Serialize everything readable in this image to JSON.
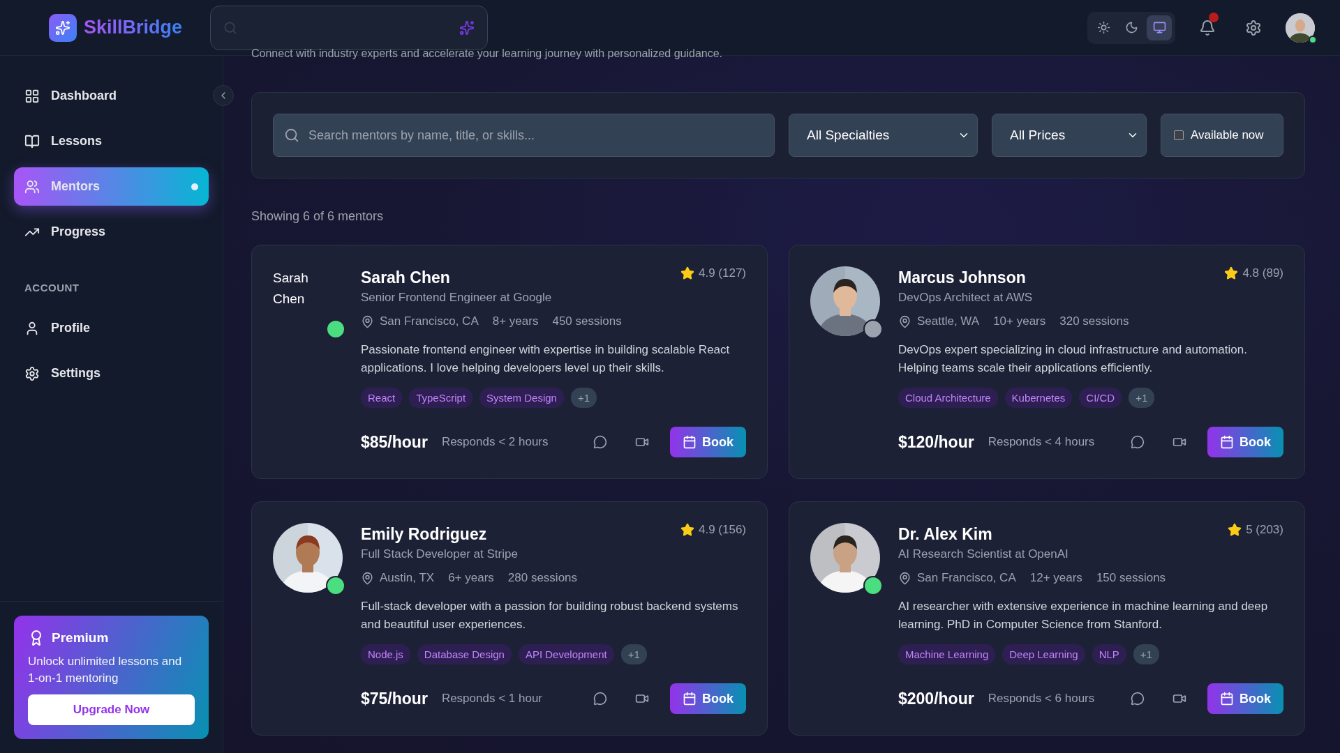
{
  "brand": {
    "name": "SkillBridge"
  },
  "theme_modes": [
    {
      "kind": "light",
      "selected": false
    },
    {
      "kind": "dark",
      "selected": false
    },
    {
      "kind": "system",
      "selected": true
    }
  ],
  "notifications": {
    "unread": true
  },
  "user": {
    "online": true
  },
  "sidebar": {
    "collapsed": false,
    "items": [
      {
        "kind": "dashboard",
        "label": "Dashboard",
        "selected": false
      },
      {
        "kind": "lessons",
        "label": "Lessons",
        "selected": false
      },
      {
        "kind": "mentors",
        "label": "Mentors",
        "selected": true
      },
      {
        "kind": "progress",
        "label": "Progress",
        "selected": false
      }
    ],
    "section_title": "ACCOUNT",
    "account_items": [
      {
        "kind": "profile",
        "label": "Profile",
        "selected": false
      },
      {
        "kind": "settings",
        "label": "Settings",
        "selected": false
      }
    ],
    "promo": {
      "title": "Premium",
      "text": "Unlock unlimited lessons and 1-on-1 mentoring",
      "button": "Upgrade Now"
    }
  },
  "subtitle": "Connect with industry experts and accelerate your learning journey with personalized guidance.",
  "filters": {
    "search_placeholder": "Search mentors by name, title, or skills...",
    "specialty": "All Specialties",
    "price": "All Prices",
    "available_label": "Available now",
    "available_checked": false
  },
  "result_count": "Showing 6 of 6 mentors",
  "mentors": [
    {
      "name": "Sarah Chen",
      "avatar_alt": "Sarah Chen",
      "kind": "broken",
      "online": true,
      "title": "Senior Frontend Engineer at Google",
      "rating": "4.9 (127)",
      "location": "San Francisco, CA",
      "experience": "8+ years",
      "sessions": "450 sessions",
      "bio": "Passionate frontend engineer with expertise in building scalable React applications. I love helping developers level up their skills.",
      "tags": [
        "React",
        "TypeScript",
        "System Design"
      ],
      "more": "+1",
      "price": "$85/hour",
      "response": "Responds < 2 hours",
      "book": "Book"
    },
    {
      "name": "Marcus Johnson",
      "kind": "picture",
      "online": false,
      "title": "DevOps Architect at AWS",
      "rating": "4.8 (89)",
      "location": "Seattle, WA",
      "experience": "10+ years",
      "sessions": "320 sessions",
      "bio": "DevOps expert specializing in cloud infrastructure and automation. Helping teams scale their applications efficiently.",
      "tags": [
        "Cloud Architecture",
        "Kubernetes",
        "CI/CD"
      ],
      "more": "+1",
      "price": "$120/hour",
      "response": "Responds < 4 hours",
      "book": "Book"
    },
    {
      "name": "Emily Rodriguez",
      "kind": "picture",
      "online": true,
      "title": "Full Stack Developer at Stripe",
      "rating": "4.9 (156)",
      "location": "Austin, TX",
      "experience": "6+ years",
      "sessions": "280 sessions",
      "bio": "Full-stack developer with a passion for building robust backend systems and beautiful user experiences.",
      "tags": [
        "Node.js",
        "Database Design",
        "API Development"
      ],
      "more": "+1",
      "price": "$75/hour",
      "response": "Responds < 1 hour",
      "book": "Book"
    },
    {
      "name": "Dr. Alex Kim",
      "kind": "picture",
      "online": true,
      "title": "AI Research Scientist at OpenAI",
      "rating": "5 (203)",
      "location": "San Francisco, CA",
      "experience": "12+ years",
      "sessions": "150 sessions",
      "bio": "AI researcher with extensive experience in machine learning and deep learning. PhD in Computer Science from Stanford.",
      "tags": [
        "Machine Learning",
        "Deep Learning",
        "NLP"
      ],
      "more": "+1",
      "price": "$200/hour",
      "response": "Responds < 6 hours",
      "book": "Book"
    }
  ]
}
